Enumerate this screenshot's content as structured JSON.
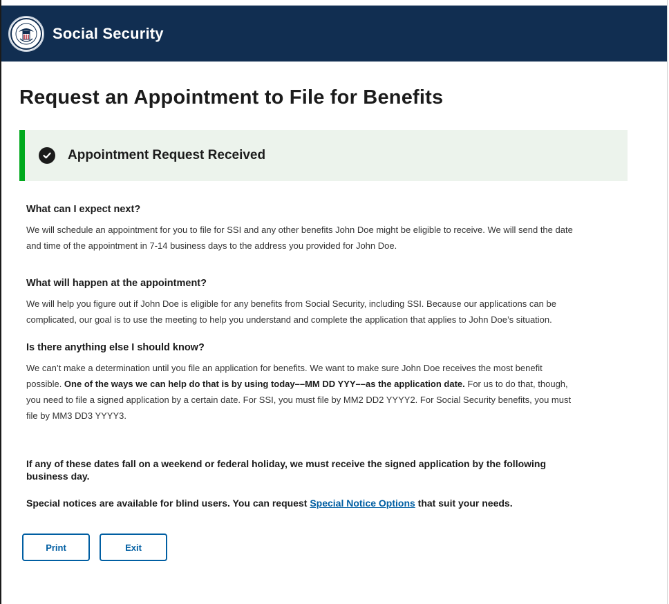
{
  "header": {
    "brand": "Social Security",
    "seal_icon": "ssa-seal-icon",
    "bg_color": "#112e51"
  },
  "page": {
    "title": "Request an Appointment to File for Benefits"
  },
  "alert": {
    "title": "Appointment Request Received",
    "icon": "check-circle-icon",
    "accent_color": "#00a91c"
  },
  "sections": {
    "expect": {
      "heading": "What can I expect next?",
      "body": "We will schedule an appointment for you to file for SSI and any other benefits John Doe might be eligible to receive. We will send the date and time of the appointment in 7-14 business days to the address you provided for John Doe."
    },
    "happen": {
      "heading": "What will happen at the appointment?",
      "body": "We will help you figure out if John Doe is eligible for any benefits from Social Security, including SSI. Because our applications can be complicated, our goal is to use the meeting to help you understand and complete the application that applies to John Doe’s situation."
    },
    "know": {
      "heading": "Is there anything else I should know?",
      "body_before": "We can’t make a determination until you file an application for benefits. We want to make sure John Doe receives the most benefit possible. ",
      "body_bold": "One of the ways we can help do that is by using today––MM DD YYY––as the application date.",
      "body_after": " For us to do that, though, you need to file a signed application by a certain date. For SSI, you must file by MM2 DD2 YYYY2. For Social Security benefits, you must file by MM3 DD3 YYYY3."
    }
  },
  "notices": {
    "weekend": "If any of these dates fall on a weekend or federal holiday, we must receive the signed application by the following business day.",
    "special_before": "Special notices are available for blind users. You can request ",
    "special_link": "Special Notice Options",
    "special_after": " that suit your needs."
  },
  "buttons": {
    "print": "Print",
    "exit": "Exit"
  }
}
